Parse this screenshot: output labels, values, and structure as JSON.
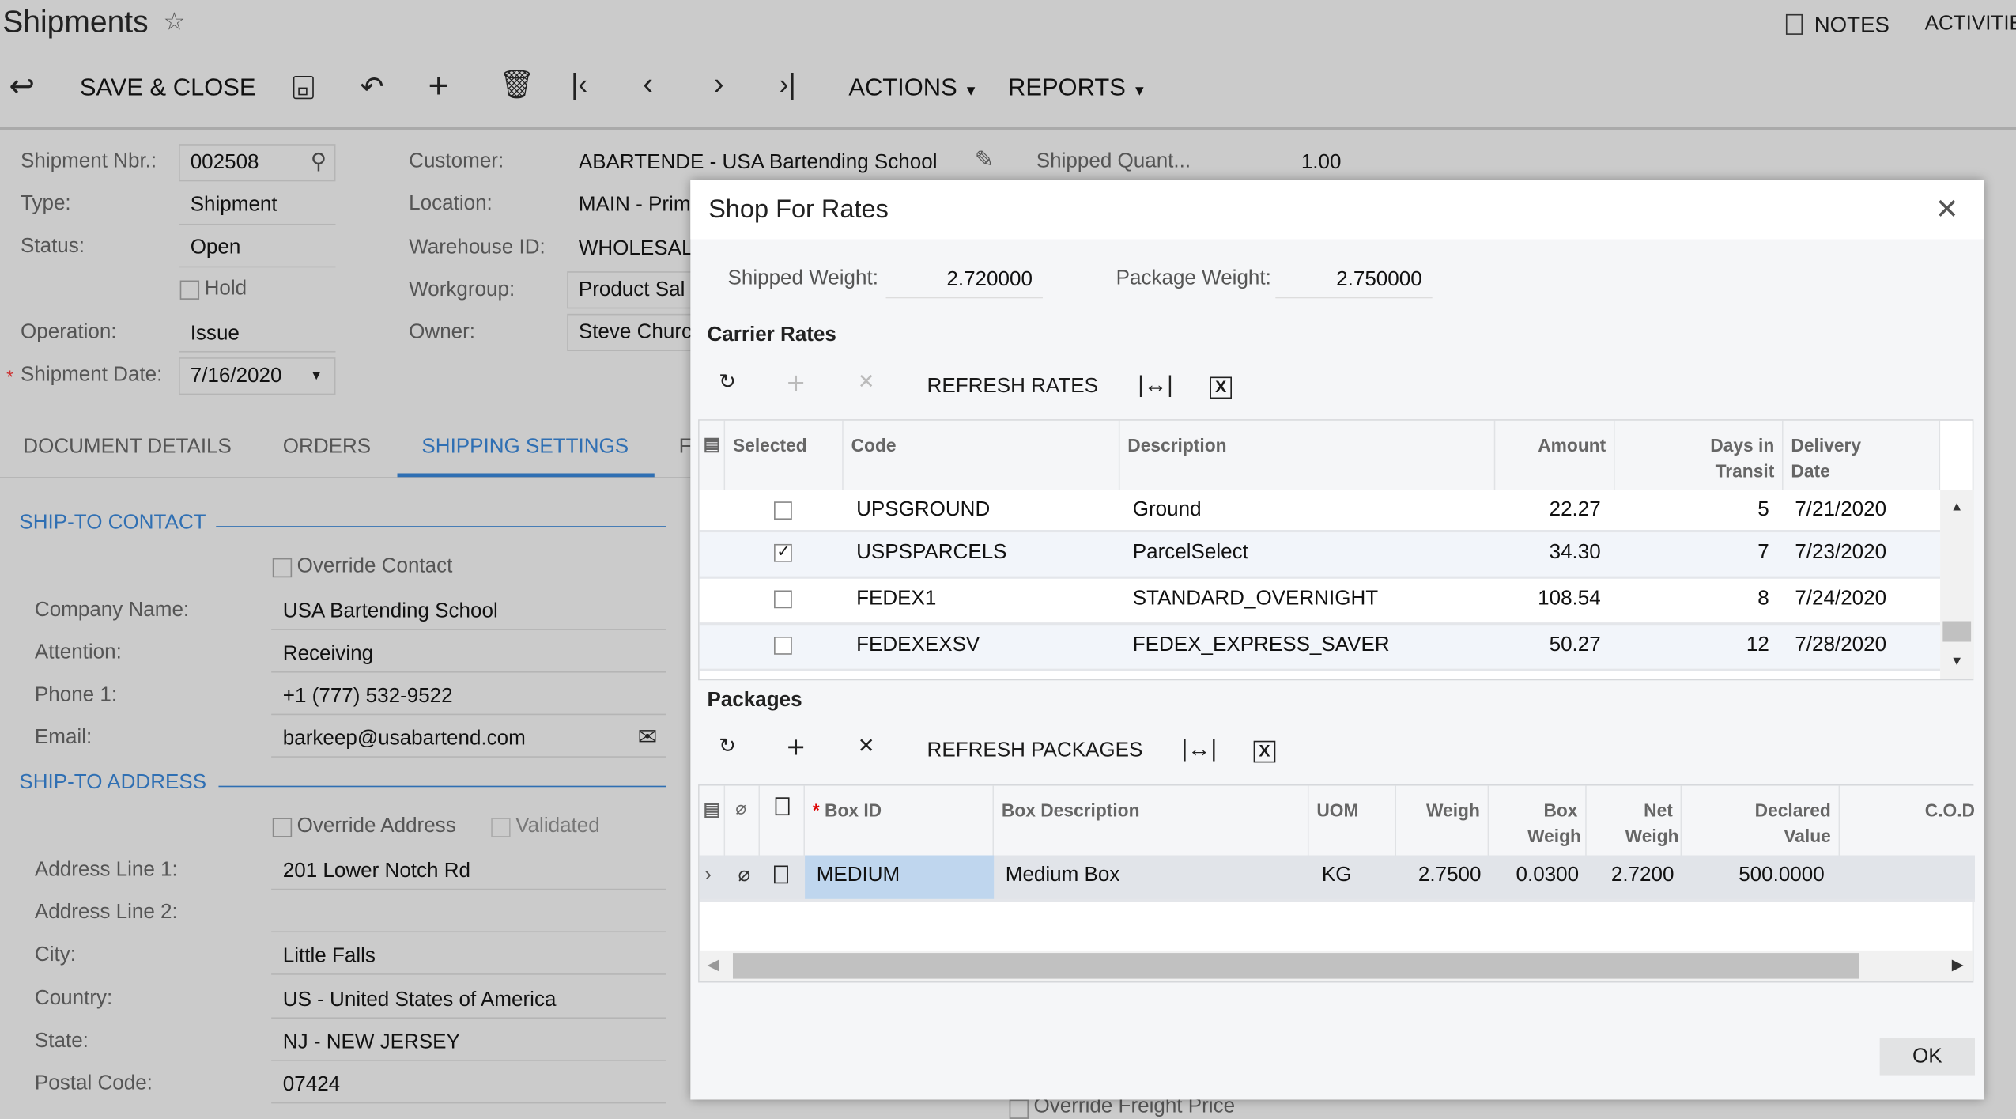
{
  "page": {
    "title": "Shipments",
    "notes": "NOTES",
    "activities": "ACTIVITIE"
  },
  "toolbar": {
    "save_close": "SAVE & CLOSE",
    "actions": "ACTIONS",
    "reports": "REPORTS"
  },
  "form": {
    "shipment_nbr": {
      "label": "Shipment Nbr.:",
      "value": "002508"
    },
    "type": {
      "label": "Type:",
      "value": "Shipment"
    },
    "status": {
      "label": "Status:",
      "value": "Open"
    },
    "hold": {
      "label": "Hold",
      "checked": false
    },
    "operation": {
      "label": "Operation:",
      "value": "Issue"
    },
    "shipment_date": {
      "label": "Shipment Date:",
      "value": "7/16/2020"
    },
    "customer": {
      "label": "Customer:",
      "value": "ABARTENDE - USA Bartending School"
    },
    "location": {
      "label": "Location:",
      "value": "MAIN - Prim"
    },
    "warehouse": {
      "label": "Warehouse ID:",
      "value": "WHOLESAL"
    },
    "workgroup": {
      "label": "Workgroup:",
      "value": "Product Sal"
    },
    "owner": {
      "label": "Owner:",
      "value": "Steve Churc"
    },
    "shipped_qty": {
      "label": "Shipped Quant...",
      "value": "1.00"
    }
  },
  "tabs": [
    {
      "label": "DOCUMENT DETAILS"
    },
    {
      "label": "ORDERS"
    },
    {
      "label": "SHIPPING SETTINGS",
      "active": true
    },
    {
      "label": "F"
    }
  ],
  "contact": {
    "header": "SHIP-TO CONTACT",
    "override": "Override Contact",
    "company": {
      "label": "Company Name:",
      "value": "USA Bartending School"
    },
    "attention": {
      "label": "Attention:",
      "value": "Receiving"
    },
    "phone": {
      "label": "Phone 1:",
      "value": "+1 (777) 532-9522"
    },
    "email": {
      "label": "Email:",
      "value": "barkeep@usabartend.com"
    }
  },
  "address": {
    "header": "SHIP-TO ADDRESS",
    "override": "Override Address",
    "validated": "Validated",
    "line1": {
      "label": "Address Line 1:",
      "value": "201 Lower Notch Rd"
    },
    "line2": {
      "label": "Address Line 2:",
      "value": ""
    },
    "city": {
      "label": "City:",
      "value": "Little Falls"
    },
    "country": {
      "label": "Country:",
      "value": "US - United States of America"
    },
    "state": {
      "label": "State:",
      "value": "NJ - NEW JERSEY"
    },
    "postal": {
      "label": "Postal Code:",
      "value": "07424"
    }
  },
  "freight": {
    "override": "Override Freight Price"
  },
  "dialog": {
    "title": "Shop For Rates",
    "shipped_weight": {
      "label": "Shipped Weight:",
      "value": "2.720000"
    },
    "package_weight": {
      "label": "Package Weight:",
      "value": "2.750000"
    },
    "carrier": {
      "title": "Carrier Rates",
      "refresh": "REFRESH RATES",
      "columns": [
        "Selected",
        "Code",
        "Description",
        "Amount",
        "Days in Transit",
        "Delivery Date"
      ],
      "rows": [
        {
          "selected": false,
          "code": "UPSGROUND",
          "description": "Ground",
          "amount": "22.27",
          "days": "5",
          "date": "7/21/2020"
        },
        {
          "selected": true,
          "code": "USPSPARCELS",
          "description": "ParcelSelect",
          "amount": "34.30",
          "days": "7",
          "date": "7/23/2020"
        },
        {
          "selected": false,
          "code": "FEDEX1",
          "description": "STANDARD_OVERNIGHT",
          "amount": "108.54",
          "days": "8",
          "date": "7/24/2020"
        },
        {
          "selected": false,
          "code": "FEDEXEXSV",
          "description": "FEDEX_EXPRESS_SAVER",
          "amount": "50.27",
          "days": "12",
          "date": "7/28/2020"
        }
      ]
    },
    "packages": {
      "title": "Packages",
      "refresh": "REFRESH PACKAGES",
      "columns": [
        "Box ID",
        "Box Description",
        "UOM",
        "Weigh",
        "Box Weigh",
        "Net Weigh",
        "Declared Value",
        "C.O.D"
      ],
      "rows": [
        {
          "box_id": "MEDIUM",
          "description": "Medium Box",
          "uom": "KG",
          "weight": "2.7500",
          "box_weight": "0.0300",
          "net_weight": "2.7200",
          "declared": "500.0000"
        }
      ]
    },
    "ok": "OK"
  },
  "colors": {
    "accent": "#2f6fb3",
    "selected_cell": "#bfd6ee"
  }
}
